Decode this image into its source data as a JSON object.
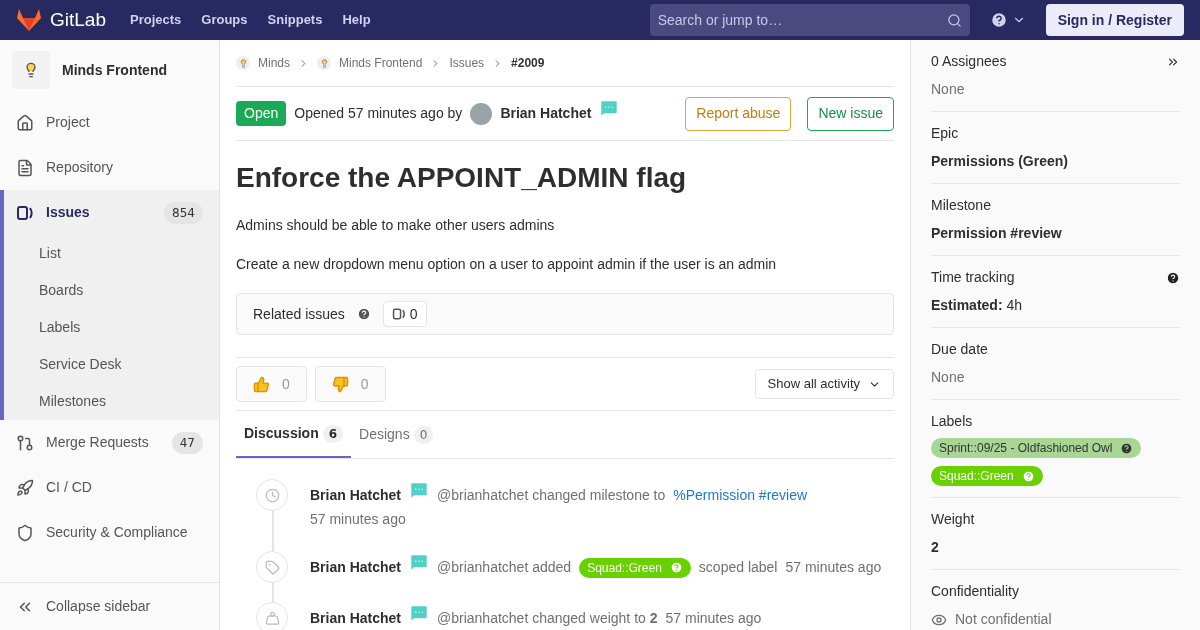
{
  "topbar": {
    "brand": "GitLab",
    "nav": [
      "Projects",
      "Groups",
      "Snippets",
      "Help"
    ],
    "search": {
      "placeholder": "Search or jump to…"
    },
    "signin": "Sign in / Register"
  },
  "sidebar": {
    "project": "Minds Frontend",
    "items": [
      {
        "label": "Project",
        "kind": "home",
        "selected": false
      },
      {
        "label": "Repository",
        "kind": "file",
        "selected": false
      },
      {
        "label": "Issues",
        "kind": "issues",
        "count": "854",
        "selected": true,
        "children": [
          {
            "label": "List"
          },
          {
            "label": "Boards"
          },
          {
            "label": "Labels"
          },
          {
            "label": "Service Desk"
          },
          {
            "label": "Milestones"
          }
        ]
      },
      {
        "label": "Merge Requests",
        "kind": "merge",
        "count": "47",
        "selected": false
      },
      {
        "label": "CI / CD",
        "kind": "rocket",
        "selected": false
      },
      {
        "label": "Security & Compliance",
        "kind": "shield",
        "selected": false
      }
    ],
    "collapse": "Collapse sidebar"
  },
  "breadcrumbs": [
    {
      "label": "Minds",
      "avatar": true
    },
    {
      "label": "Minds Frontend",
      "avatar": true
    },
    {
      "label": "Issues",
      "avatar": false
    },
    {
      "label": "#2009",
      "avatar": false
    }
  ],
  "issue": {
    "status": "Open",
    "opened": "Opened 57 minutes ago by",
    "author": "Brian Hatchet",
    "report": "Report abuse",
    "new": "New issue",
    "title": "Enforce the APPOINT_ADMIN flag",
    "paragraphs": [
      "Admins should be able to make other users admins",
      "Create a new dropdown menu option on a user to appoint admin if the user is an admin"
    ],
    "related": {
      "label": "Related issues",
      "count": "0"
    },
    "reactions": [
      {
        "kind": "up",
        "count": "0"
      },
      {
        "kind": "down",
        "count": "0"
      }
    ],
    "filter": "Show all activity",
    "tabs": [
      {
        "label": "Discussion",
        "count": "6",
        "selected": true
      },
      {
        "label": "Designs",
        "count": "0",
        "selected": false
      }
    ],
    "events": [
      {
        "kind": "clock",
        "author": "Brian Hatchet",
        "text": "@brianhatchet changed milestone to",
        "link": "%Permission #review",
        "time": "57 minutes ago",
        "time_below": true
      },
      {
        "kind": "tag",
        "author": "Brian Hatchet",
        "text": "@brianhatchet added",
        "label": {
          "text": "Squad::Green",
          "color": "#69d100"
        },
        "after": "scoped label",
        "time": "57 minutes ago",
        "time_below": false
      },
      {
        "kind": "weight",
        "author": "Brian Hatchet",
        "text": "@brianhatchet changed weight to **2**",
        "time": "57 minutes ago",
        "time_below": false
      }
    ]
  },
  "right": {
    "sections": [
      {
        "kind": "assignees",
        "title": "0 Assignees",
        "value": "None",
        "muted": true
      },
      {
        "kind": "plain",
        "title": "Epic",
        "value": "Permissions (Green)",
        "muted": false
      },
      {
        "kind": "plain",
        "title": "Milestone",
        "value": "Permission #review",
        "muted": false
      },
      {
        "kind": "time",
        "title": "Time tracking",
        "value": "**Estimated:** 4h",
        "muted": false
      },
      {
        "kind": "plain",
        "title": "Due date",
        "value": "None",
        "muted": true
      },
      {
        "kind": "labels",
        "title": "Labels",
        "labels": [
          {
            "text": "Sprint::09/25 - Oldfashioned Owl",
            "color": "#a8d695"
          },
          {
            "text": "Squad::Green",
            "color": "#69d100"
          }
        ]
      },
      {
        "kind": "plain",
        "title": "Weight",
        "value": "2",
        "muted": false
      },
      {
        "kind": "confidential",
        "title": "Confidentiality",
        "value": "Not confidential",
        "muted": true
      }
    ]
  }
}
